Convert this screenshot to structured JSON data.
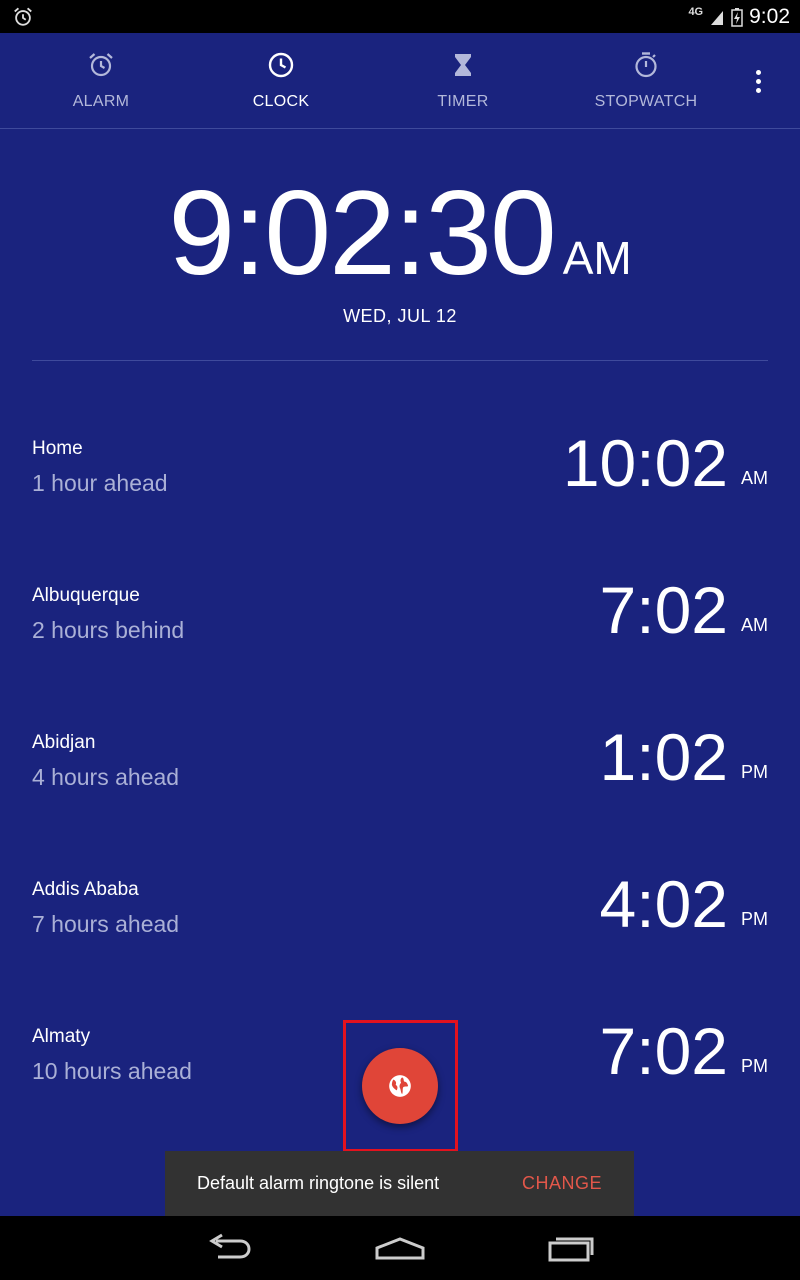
{
  "status_bar": {
    "network": "4G",
    "time": "9:02"
  },
  "tabs": [
    {
      "label": "ALARM",
      "icon": "alarm-icon",
      "active": false
    },
    {
      "label": "CLOCK",
      "icon": "clock-icon",
      "active": true
    },
    {
      "label": "TIMER",
      "icon": "hourglass-icon",
      "active": false
    },
    {
      "label": "STOPWATCH",
      "icon": "stopwatch-icon",
      "active": false
    }
  ],
  "main_clock": {
    "time": "9:02:30",
    "ampm": "AM",
    "date": "WED, JUL 12"
  },
  "cities": [
    {
      "name": "Home",
      "offset": "1 hour ahead",
      "time": "10:02",
      "ampm": "AM"
    },
    {
      "name": "Albuquerque",
      "offset": "2 hours behind",
      "time": "7:02",
      "ampm": "AM"
    },
    {
      "name": "Abidjan",
      "offset": "4 hours ahead",
      "time": "1:02",
      "ampm": "PM"
    },
    {
      "name": "Addis Ababa",
      "offset": "7 hours ahead",
      "time": "4:02",
      "ampm": "PM"
    },
    {
      "name": "Almaty",
      "offset": "10 hours ahead",
      "time": "7:02",
      "ampm": "PM"
    }
  ],
  "fab": {
    "icon": "globe-icon"
  },
  "snackbar": {
    "message": "Default alarm ringtone is silent",
    "action": "CHANGE"
  },
  "colors": {
    "background": "#1a237e",
    "fab": "#e04538",
    "snackbar_action": "#e2574a",
    "highlight": "#e3121e"
  }
}
